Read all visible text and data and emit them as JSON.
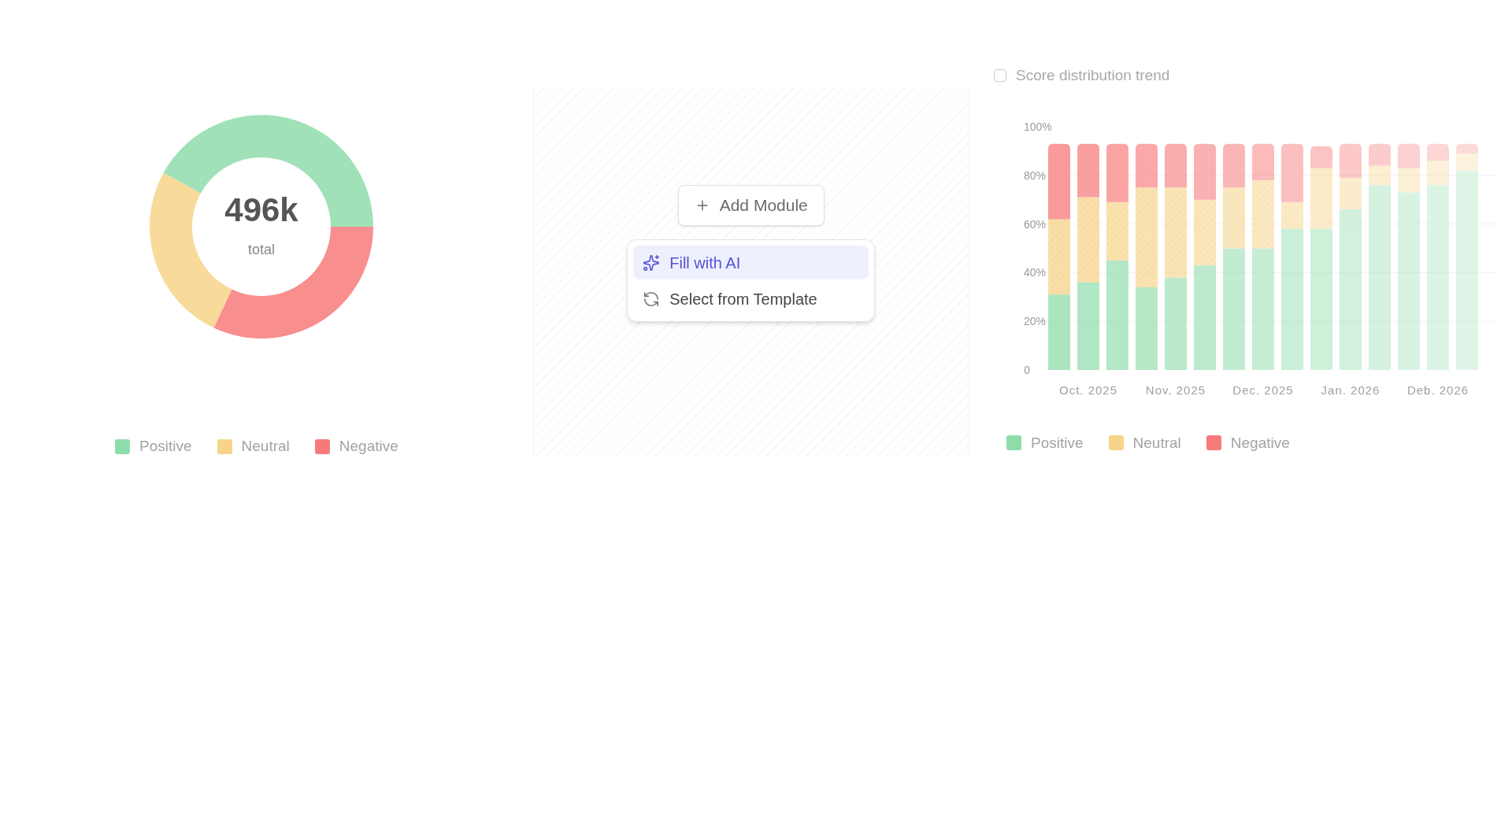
{
  "donut_panel": {
    "total": "496k",
    "total_label": "total",
    "chart_data": {
      "type": "donut",
      "categories": [
        "Positive",
        "Neutral",
        "Negative"
      ],
      "values": [
        42,
        26,
        32
      ],
      "colors": [
        "#8fdcab",
        "#f7d48a",
        "#f77a7a"
      ]
    }
  },
  "module_panel": {
    "add_button": "Add Module",
    "menu": [
      {
        "kind": "ai",
        "label": "Fill with AI",
        "selected": true
      },
      {
        "kind": "template",
        "label": "Select from Template",
        "selected": false
      }
    ]
  },
  "trend_panel": {
    "title": "Score distribution trend",
    "chart_data": {
      "type": "bar",
      "stacked": true,
      "orientation": "vertical",
      "grid": true,
      "ylim": [
        0,
        100
      ],
      "yticks": [
        {
          "value": 0,
          "label": "0"
        },
        {
          "value": 20,
          "label": "20%"
        },
        {
          "value": 40,
          "label": "40%"
        },
        {
          "value": 60,
          "label": "60%"
        },
        {
          "value": 80,
          "label": "80%"
        },
        {
          "value": 100,
          "label": "100%"
        }
      ],
      "categories": [
        null,
        "Oct. 2025",
        null,
        null,
        "Nov. 2025",
        null,
        null,
        "Dec. 2025",
        null,
        null,
        "Jan. 2026",
        null,
        null,
        "Deb. 2026",
        null
      ],
      "series": [
        {
          "name": "Positive",
          "color": "#8fdcab",
          "values": [
            31,
            36,
            45,
            34,
            38,
            43,
            50,
            50,
            58,
            58,
            66,
            76,
            73,
            76,
            82
          ]
        },
        {
          "name": "Neutral",
          "color": "#f7d48a",
          "values": [
            31,
            35,
            24,
            41,
            37,
            27,
            25,
            28,
            11,
            25,
            13,
            8,
            10,
            10,
            7
          ]
        },
        {
          "name": "Negative",
          "color": "#f77a7a",
          "values": [
            31,
            22,
            24,
            18,
            18,
            23,
            18,
            15,
            24,
            9,
            14,
            9,
            10,
            7,
            4
          ]
        }
      ]
    }
  }
}
